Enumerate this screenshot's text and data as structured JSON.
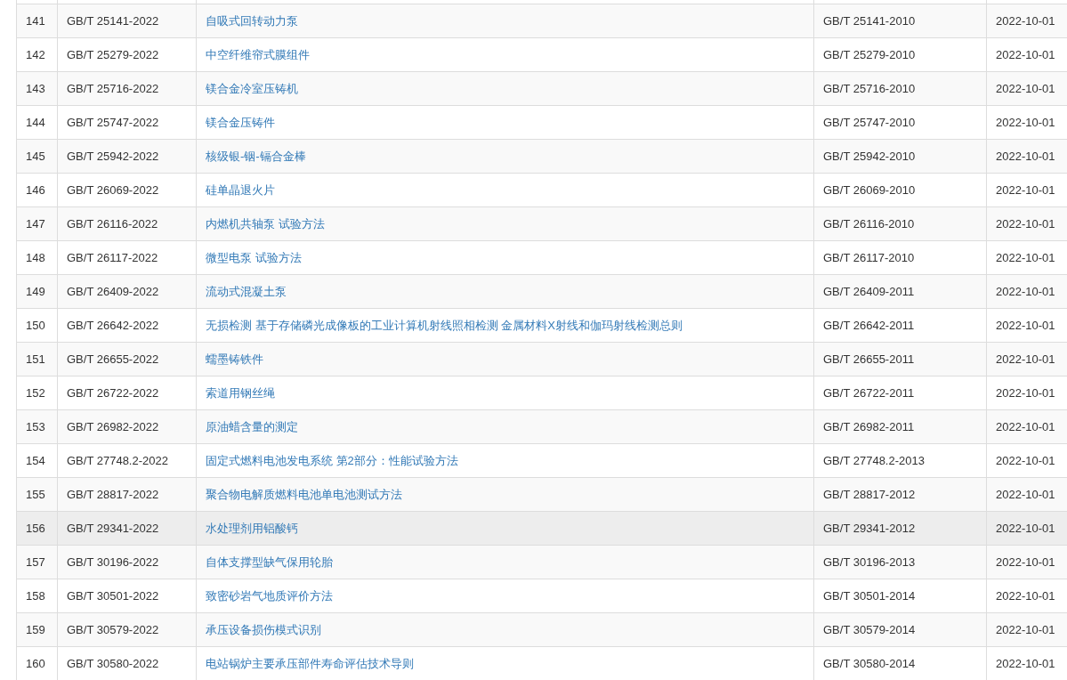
{
  "table": {
    "rows": [
      {
        "index": "141",
        "standard_no": "GB/T 25141-2022",
        "title": "自吸式回转动力泵",
        "replaces": "GB/T 25141-2010",
        "effective_date": "2022-10-01",
        "hovered": false
      },
      {
        "index": "142",
        "standard_no": "GB/T 25279-2022",
        "title": "中空纤维帘式膜组件",
        "replaces": "GB/T 25279-2010",
        "effective_date": "2022-10-01",
        "hovered": false
      },
      {
        "index": "143",
        "standard_no": "GB/T 25716-2022",
        "title": "镁合金冷室压铸机",
        "replaces": "GB/T 25716-2010",
        "effective_date": "2022-10-01",
        "hovered": false
      },
      {
        "index": "144",
        "standard_no": "GB/T 25747-2022",
        "title": "镁合金压铸件",
        "replaces": "GB/T 25747-2010",
        "effective_date": "2022-10-01",
        "hovered": false
      },
      {
        "index": "145",
        "standard_no": "GB/T 25942-2022",
        "title": "核级银-铟-镉合金棒",
        "replaces": "GB/T 25942-2010",
        "effective_date": "2022-10-01",
        "hovered": false
      },
      {
        "index": "146",
        "standard_no": "GB/T 26069-2022",
        "title": "硅单晶退火片",
        "replaces": "GB/T 26069-2010",
        "effective_date": "2022-10-01",
        "hovered": false
      },
      {
        "index": "147",
        "standard_no": "GB/T 26116-2022",
        "title": "内燃机共轴泵 试验方法",
        "replaces": "GB/T 26116-2010",
        "effective_date": "2022-10-01",
        "hovered": false
      },
      {
        "index": "148",
        "standard_no": "GB/T 26117-2022",
        "title": "微型电泵 试验方法",
        "replaces": "GB/T 26117-2010",
        "effective_date": "2022-10-01",
        "hovered": false
      },
      {
        "index": "149",
        "standard_no": "GB/T 26409-2022",
        "title": "流动式混凝土泵",
        "replaces": "GB/T 26409-2011",
        "effective_date": "2022-10-01",
        "hovered": false
      },
      {
        "index": "150",
        "standard_no": "GB/T 26642-2022",
        "title": "无损检测 基于存储磷光成像板的工业计算机射线照相检测 金属材料X射线和伽玛射线检测总则",
        "replaces": "GB/T 26642-2011",
        "effective_date": "2022-10-01",
        "hovered": false
      },
      {
        "index": "151",
        "standard_no": "GB/T 26655-2022",
        "title": "蠕墨铸铁件",
        "replaces": "GB/T 26655-2011",
        "effective_date": "2022-10-01",
        "hovered": false
      },
      {
        "index": "152",
        "standard_no": "GB/T 26722-2022",
        "title": "索道用钢丝绳",
        "replaces": "GB/T 26722-2011",
        "effective_date": "2022-10-01",
        "hovered": false
      },
      {
        "index": "153",
        "standard_no": "GB/T 26982-2022",
        "title": "原油蜡含量的测定",
        "replaces": "GB/T 26982-2011",
        "effective_date": "2022-10-01",
        "hovered": false
      },
      {
        "index": "154",
        "standard_no": "GB/T 27748.2-2022",
        "title": "固定式燃料电池发电系统 第2部分：性能试验方法",
        "replaces": "GB/T 27748.2-2013",
        "effective_date": "2022-10-01",
        "hovered": false
      },
      {
        "index": "155",
        "standard_no": "GB/T 28817-2022",
        "title": "聚合物电解质燃料电池单电池测试方法",
        "replaces": "GB/T 28817-2012",
        "effective_date": "2022-10-01",
        "hovered": false
      },
      {
        "index": "156",
        "standard_no": "GB/T 29341-2022",
        "title": "水处理剂用铝酸钙",
        "replaces": "GB/T 29341-2012",
        "effective_date": "2022-10-01",
        "hovered": true
      },
      {
        "index": "157",
        "standard_no": "GB/T 30196-2022",
        "title": "自体支撑型缺气保用轮胎",
        "replaces": "GB/T 30196-2013",
        "effective_date": "2022-10-01",
        "hovered": false
      },
      {
        "index": "158",
        "standard_no": "GB/T 30501-2022",
        "title": "致密砂岩气地质评价方法",
        "replaces": "GB/T 30501-2014",
        "effective_date": "2022-10-01",
        "hovered": false
      },
      {
        "index": "159",
        "standard_no": "GB/T 30579-2022",
        "title": "承压设备损伤模式识别",
        "replaces": "GB/T 30579-2014",
        "effective_date": "2022-10-01",
        "hovered": false
      },
      {
        "index": "160",
        "standard_no": "GB/T 30580-2022",
        "title": "电站锅炉主要承压部件寿命评估技术导则",
        "replaces": "GB/T 30580-2014",
        "effective_date": "2022-10-01",
        "hovered": false
      }
    ]
  }
}
